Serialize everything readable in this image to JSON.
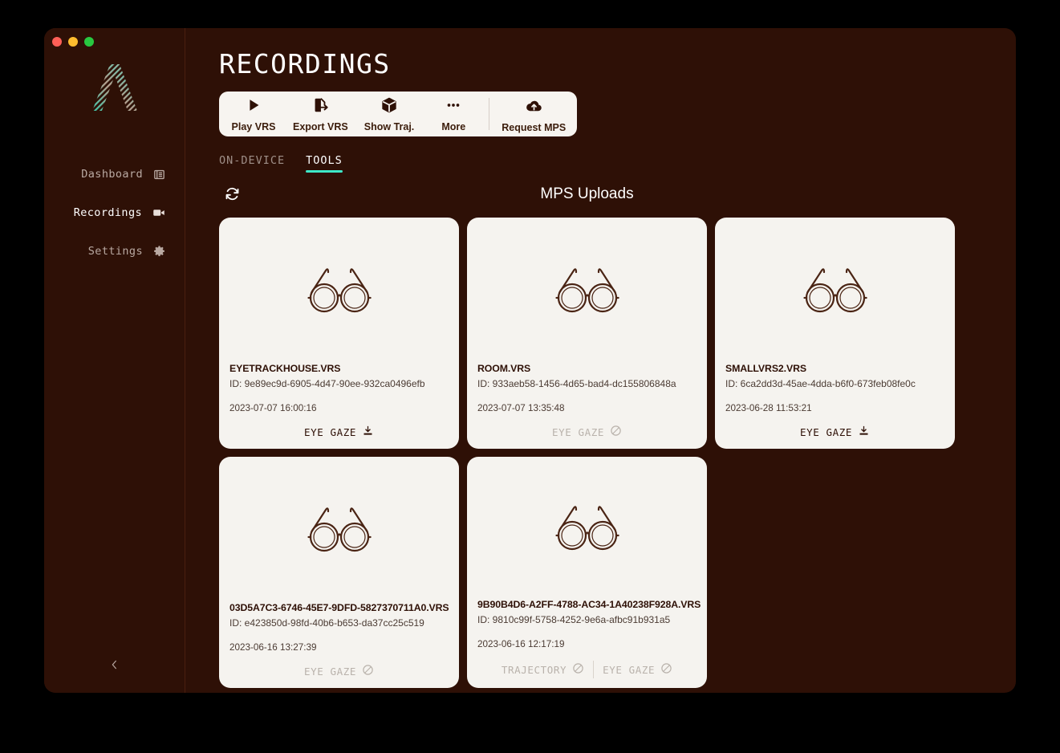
{
  "window": {
    "traffic_lights": [
      "close",
      "minimize",
      "maximize"
    ]
  },
  "theme": {
    "background": "#2e1006",
    "card_background": "#f5f3ef",
    "accent": "#3ee8c8",
    "text_light": "#ffffff",
    "text_muted": "#b9a9a2",
    "text_dark": "#2e1006"
  },
  "sidebar": {
    "logo_name": "aria-logo",
    "items": [
      {
        "label": "Dashboard",
        "icon": "newspaper-icon",
        "active": false
      },
      {
        "label": "Recordings",
        "icon": "video-camera-icon",
        "active": true
      },
      {
        "label": "Settings",
        "icon": "gear-icon",
        "active": false
      }
    ],
    "collapse_icon": "chevron-left-icon"
  },
  "header": {
    "title": "RECORDINGS"
  },
  "toolbar": {
    "buttons": [
      {
        "label": "Play VRS",
        "icon": "play-icon"
      },
      {
        "label": "Export VRS",
        "icon": "export-file-icon"
      },
      {
        "label": "Show Traj.",
        "icon": "cube-icon"
      },
      {
        "label": "More",
        "icon": "ellipsis-icon"
      },
      {
        "label": "Request MPS",
        "icon": "cloud-upload-icon"
      }
    ]
  },
  "tabs": [
    {
      "label": "ON-DEVICE",
      "active": false
    },
    {
      "label": "TOOLS",
      "active": true
    }
  ],
  "section": {
    "title": "MPS Uploads",
    "refresh_icon": "refresh-icon"
  },
  "cards": [
    {
      "name": "EYETRACKHOUSE.VRS",
      "id": "ID: 9e89ec9d-6905-4d47-90ee-932ca0496efb",
      "date": "2023-07-07 16:00:16",
      "thumb_icon": "glasses-icon",
      "actions": [
        {
          "label": "EYE GAZE",
          "icon": "download-icon",
          "disabled": false
        }
      ]
    },
    {
      "name": "ROOM.VRS",
      "id": "ID: 933aeb58-1456-4d65-bad4-dc155806848a",
      "date": "2023-07-07 13:35:48",
      "thumb_icon": "glasses-icon",
      "actions": [
        {
          "label": "EYE GAZE",
          "icon": "no-entry-icon",
          "disabled": true
        }
      ]
    },
    {
      "name": "SMALLVRS2.VRS",
      "id": "ID: 6ca2dd3d-45ae-4dda-b6f0-673feb08fe0c",
      "date": "2023-06-28 11:53:21",
      "thumb_icon": "glasses-icon",
      "actions": [
        {
          "label": "EYE GAZE",
          "icon": "download-icon",
          "disabled": false
        }
      ]
    },
    {
      "name": "03D5A7C3-6746-45E7-9DFD-5827370711A0.VRS",
      "id": "ID: e423850d-98fd-40b6-b653-da37cc25c519",
      "date": "2023-06-16 13:27:39",
      "thumb_icon": "glasses-icon",
      "actions": [
        {
          "label": "EYE GAZE",
          "icon": "no-entry-icon",
          "disabled": true
        }
      ]
    },
    {
      "name": "9B90B4D6-A2FF-4788-AC34-1A40238F928A.VRS",
      "id": "ID: 9810c99f-5758-4252-9e6a-afbc91b931a5",
      "date": "2023-06-16 12:17:19",
      "thumb_icon": "glasses-icon",
      "actions": [
        {
          "label": "TRAJECTORY",
          "icon": "no-entry-icon",
          "disabled": true
        },
        {
          "label": "EYE GAZE",
          "icon": "no-entry-icon",
          "disabled": true
        }
      ]
    }
  ]
}
